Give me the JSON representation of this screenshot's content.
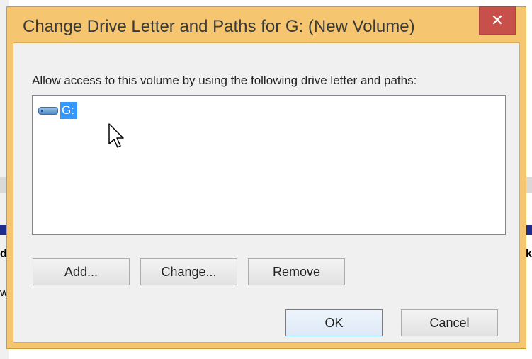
{
  "dialog": {
    "title": "Change Drive Letter and Paths for G: (New Volume)",
    "close_symbol": "✕",
    "prompt": "Allow access to this volume by using the following drive letter and paths:",
    "list_items": [
      {
        "label": "G:",
        "icon": "drive-icon",
        "selected": true
      }
    ],
    "buttons": {
      "add": "Add...",
      "change": "Change...",
      "remove": "Remove",
      "ok": "OK",
      "cancel": "Cancel"
    }
  },
  "background": {
    "left_char_1": "d",
    "left_char_2": "w",
    "right_char": "k"
  },
  "colors": {
    "frame": "#f5c66f",
    "close": "#c7504b",
    "selection": "#3399ff",
    "default_button_border": "#3c8bd9"
  }
}
